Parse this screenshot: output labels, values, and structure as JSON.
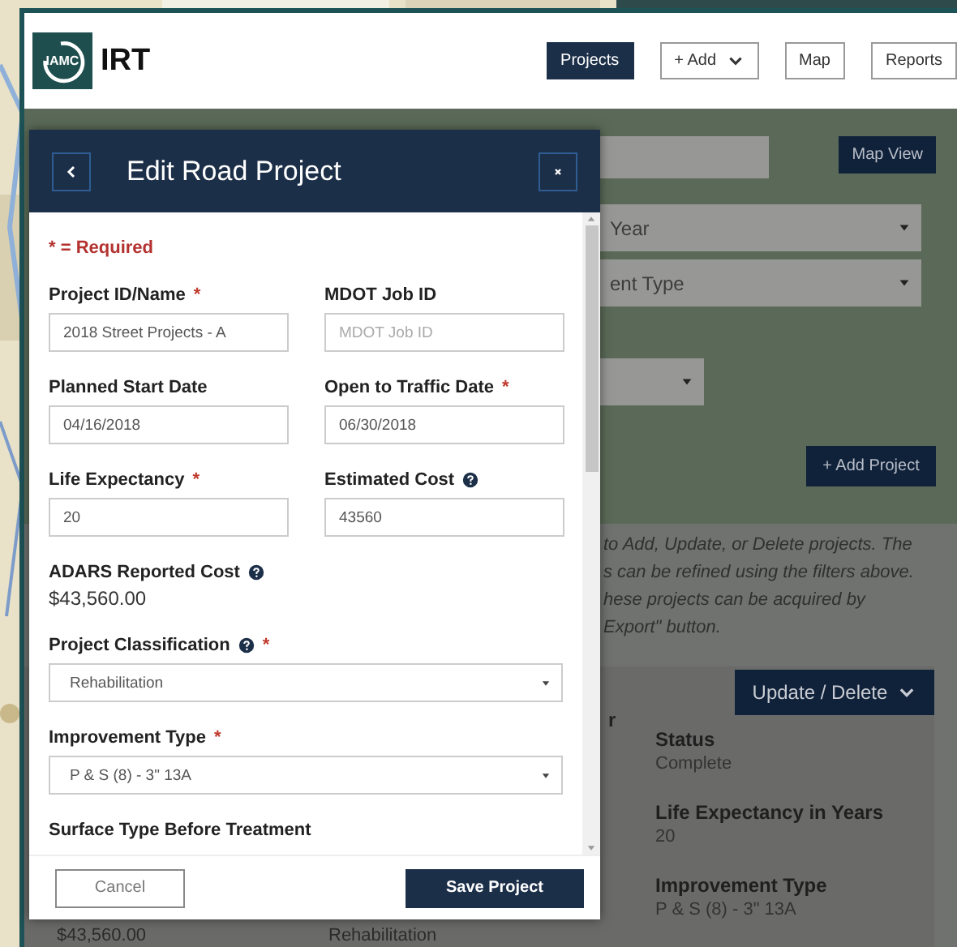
{
  "app": {
    "logo_text": "IAMC",
    "name": "IRT"
  },
  "nav": [
    {
      "label": "Projects",
      "kind": "plain",
      "selected": true
    },
    {
      "label": "+ Add",
      "kind": "dropdown",
      "selected": false
    },
    {
      "label": "Map",
      "kind": "plain",
      "selected": false
    },
    {
      "label": "Reports",
      "kind": "plain",
      "selected": false
    }
  ],
  "filters": {
    "map_view_button": "Map View",
    "selects": [
      {
        "kind": "wide",
        "value": "Year"
      },
      {
        "kind": "wide",
        "value": "ent Type"
      },
      {
        "kind": "short"
      }
    ],
    "add_project_button": "+ Add Project"
  },
  "info_lines": [
    "to Add, Update, or Delete projects. The",
    "s can be refined using the filters above.",
    "hese projects can be acquired by",
    "Export\" button."
  ],
  "detail": {
    "left_values": [
      "$43,560.00",
      "Rehabilitation"
    ],
    "action_button": "Update / Delete",
    "column_fragment": "r",
    "fields": [
      {
        "label": "Status",
        "value": "Complete"
      },
      {
        "label": "Life Expectancy in Years",
        "value": "20"
      },
      {
        "label": "Improvement Type",
        "value": "P & S (8) - 3\" 13A"
      }
    ]
  },
  "modal": {
    "title": "Edit Road Project",
    "required_note": "* = Required",
    "fields": [
      {
        "kind": "input",
        "label": "Project ID/Name",
        "required_mark": "*",
        "help": false,
        "value": "2018 Street Projects - A"
      },
      {
        "kind": "input",
        "label": "MDOT Job ID",
        "help": false,
        "placeholder": "MDOT Job ID"
      },
      {
        "kind": "input",
        "label": "Planned Start Date",
        "help": false,
        "value": "04/16/2018"
      },
      {
        "kind": "input",
        "label": "Open to Traffic Date",
        "required_mark": "*",
        "help": false,
        "value": "06/30/2018"
      },
      {
        "kind": "input",
        "label": "Life Expectancy",
        "required_mark": "*",
        "help": false,
        "value": "20"
      },
      {
        "kind": "input",
        "label": "Estimated Cost",
        "help": true,
        "value": "43560"
      },
      {
        "kind": "readonly",
        "label": "ADARS Reported Cost",
        "help": true,
        "value": "$43,560.00"
      },
      {
        "kind": "select",
        "label": "Project Classification",
        "required_mark": "*",
        "help": true,
        "value": "Rehabilitation"
      },
      {
        "kind": "select",
        "label": "Improvement Type",
        "required_mark": "*",
        "help": false,
        "value": "P & S (8) - 3\" 13A"
      },
      {
        "kind": "heading",
        "label": "Surface Type Before Treatment",
        "help": false
      }
    ],
    "cancel_button": "Cancel",
    "save_button": "Save Project"
  }
}
